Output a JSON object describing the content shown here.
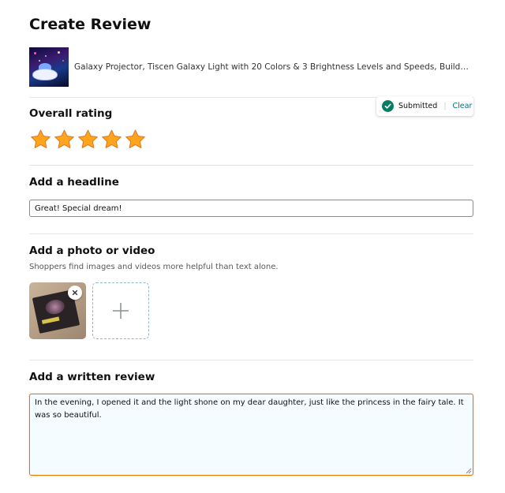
{
  "page": {
    "title": "Create Review"
  },
  "product": {
    "title": "Galaxy Projector, Tiscen Galaxy Light with 20 Colors & 3 Brightness Levels and Speeds, Build-in ..."
  },
  "rating": {
    "label": "Overall rating",
    "value": 5,
    "max": 5,
    "status": "Submitted",
    "clear_label": "Clear"
  },
  "headline": {
    "label": "Add a headline",
    "value": "Great! Special dream!"
  },
  "media": {
    "label": "Add a photo or video",
    "helper": "Shoppers find images and videos more helpful than text alone."
  },
  "review": {
    "label": "Add a written review",
    "value": "In the evening, I opened it and the light shone on my dear daughter, just like the princess in the fairy tale. It was so beautiful."
  },
  "colors": {
    "star": "#ffa41c",
    "accent_border": "#e77600",
    "link": "#007185",
    "success": "#067d62"
  },
  "icons": [
    "check-icon",
    "star-icon",
    "close-icon",
    "plus-icon",
    "resize-grip-icon"
  ]
}
